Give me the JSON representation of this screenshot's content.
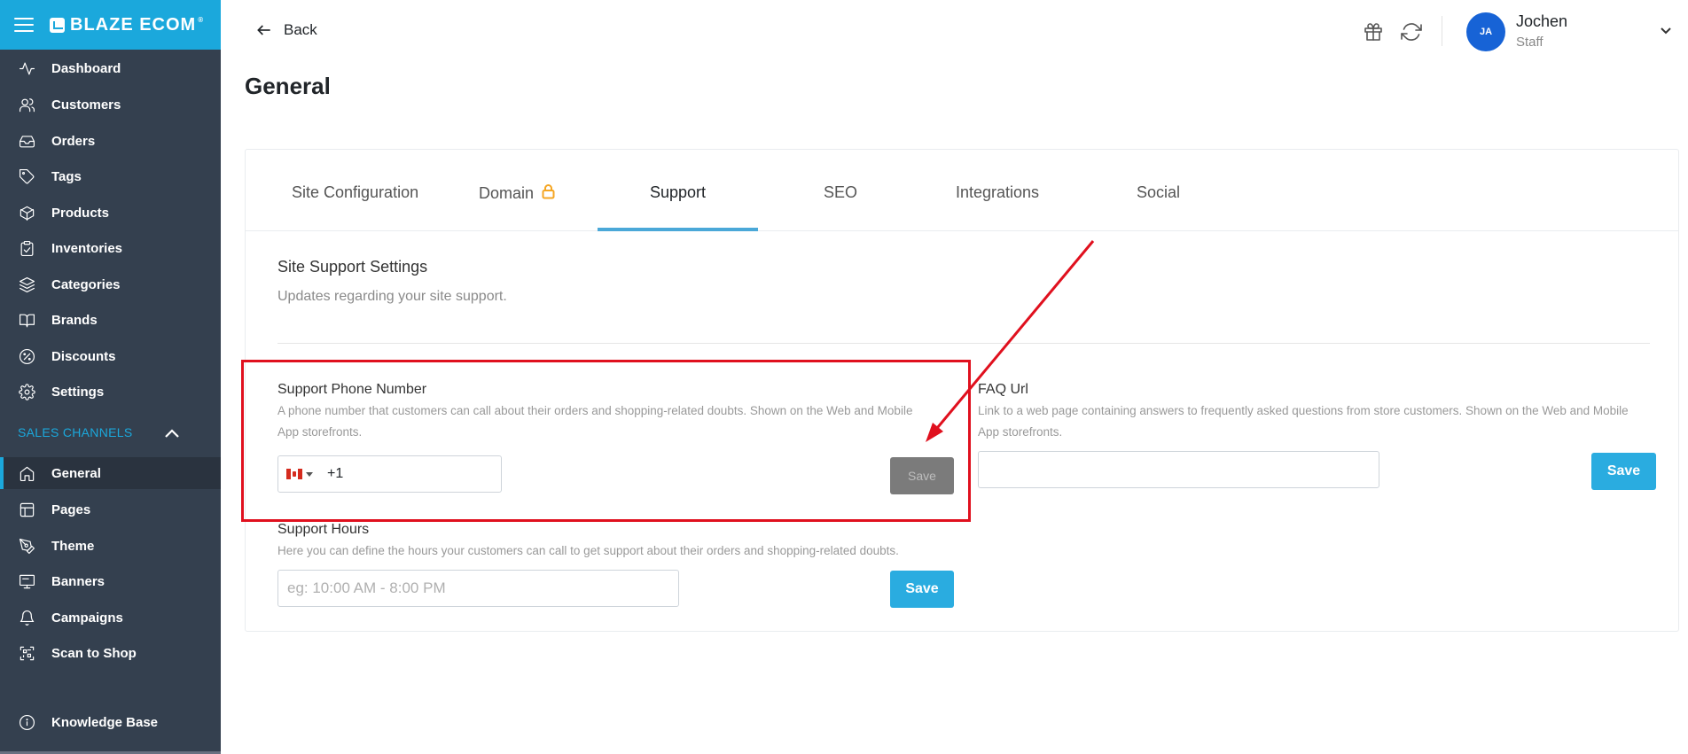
{
  "sidebar": {
    "brand": "BLAZE ECOM",
    "brand_mark": "®",
    "items": [
      {
        "label": "Dashboard",
        "icon": "activity-icon"
      },
      {
        "label": "Customers",
        "icon": "users-icon"
      },
      {
        "label": "Orders",
        "icon": "inbox-icon"
      },
      {
        "label": "Tags",
        "icon": "tag-icon"
      },
      {
        "label": "Products",
        "icon": "box-icon"
      },
      {
        "label": "Inventories",
        "icon": "clipboard-icon"
      },
      {
        "label": "Categories",
        "icon": "layers-icon"
      },
      {
        "label": "Brands",
        "icon": "book-icon"
      },
      {
        "label": "Discounts",
        "icon": "percent-icon"
      },
      {
        "label": "Settings",
        "icon": "gear-icon"
      }
    ],
    "section_label": "SALES CHANNELS",
    "channel_items": [
      {
        "label": "General",
        "icon": "home-icon",
        "active": true
      },
      {
        "label": "Pages",
        "icon": "layout-icon"
      },
      {
        "label": "Theme",
        "icon": "pen-tool-icon"
      },
      {
        "label": "Banners",
        "icon": "monitor-icon"
      },
      {
        "label": "Campaigns",
        "icon": "bell-icon"
      },
      {
        "label": "Scan to Shop",
        "icon": "qr-scan-icon"
      }
    ],
    "footer_item": {
      "label": "Knowledge Base",
      "icon": "info-icon"
    }
  },
  "header": {
    "back_label": "Back",
    "user": {
      "initials": "JA",
      "name": "Jochen",
      "role": "Staff"
    }
  },
  "page": {
    "title": "General",
    "tabs": [
      {
        "label": "Site Configuration"
      },
      {
        "label": "Domain",
        "locked": true
      },
      {
        "label": "Support",
        "active": true
      },
      {
        "label": "SEO"
      },
      {
        "label": "Integrations"
      },
      {
        "label": "Social"
      }
    ],
    "section": {
      "title": "Site Support Settings",
      "description": "Updates regarding your site support."
    },
    "phone": {
      "label": "Support Phone Number",
      "help_line1": "A phone number that customers can call about their orders and shopping-related doubts. Shown on the Web and Mobile",
      "help_line2": "App storefronts.",
      "country_code": "+1",
      "flag": "canada-flag-icon",
      "save_label": "Save"
    },
    "faq": {
      "label": "FAQ Url",
      "help_line1": "Link to a web page containing answers to frequently asked questions from store customers. Shown on the Web and Mobile",
      "help_line2": "App storefronts.",
      "value": "",
      "save_label": "Save"
    },
    "hours": {
      "label": "Support Hours",
      "help": "Here you can define the hours your customers can call to get support about their orders and shopping-related doubts.",
      "placeholder": "eg: 10:00 AM - 8:00 PM",
      "save_label": "Save"
    }
  },
  "colors": {
    "sidebar_bg": "#34404f",
    "brand": "#1ba8dc",
    "accent": "#2aace0",
    "annotation": "#e0101e",
    "disabled_button": "#7b7b7b"
  }
}
